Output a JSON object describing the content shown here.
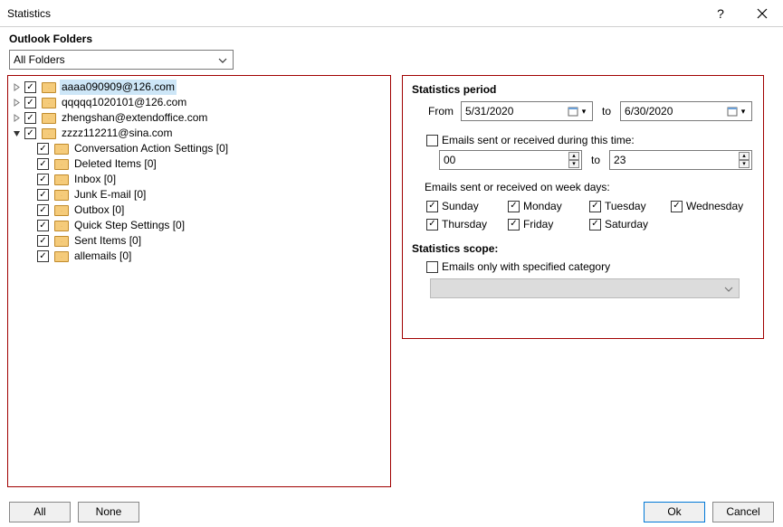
{
  "window": {
    "title": "Statistics",
    "help": "?",
    "close": "✕"
  },
  "outlook_folders": {
    "label": "Outlook Folders",
    "dropdown": "All Folders",
    "accounts": [
      {
        "name": "aaaa090909@126.com",
        "expanded": false,
        "checked": true,
        "selected": true
      },
      {
        "name": "qqqqq1020101@126.com",
        "expanded": false,
        "checked": true
      },
      {
        "name": "zhengshan@extendoffice.com",
        "expanded": false,
        "checked": true
      },
      {
        "name": "zzzz112211@sina.com",
        "expanded": true,
        "checked": true,
        "children": [
          {
            "name": "Conversation Action Settings [0]",
            "checked": true
          },
          {
            "name": "Deleted Items [0]",
            "checked": true
          },
          {
            "name": "Inbox [0]",
            "checked": true
          },
          {
            "name": "Junk E-mail [0]",
            "checked": true
          },
          {
            "name": "Outbox [0]",
            "checked": true
          },
          {
            "name": "Quick Step Settings [0]",
            "checked": true
          },
          {
            "name": "Sent Items [0]",
            "checked": true
          },
          {
            "name": "allemails [0]",
            "checked": true
          }
        ]
      }
    ]
  },
  "period": {
    "header": "Statistics period",
    "from_label": "From",
    "from_value": "5/31/2020",
    "to_label": "to",
    "to_value": "6/30/2020",
    "time_filter_label": "Emails sent or received during this time:",
    "time_filter_checked": false,
    "from_hour": "00",
    "to_hour": "23",
    "weekday_label": "Emails sent or received on week days:",
    "days": [
      {
        "label": "Sunday",
        "checked": true
      },
      {
        "label": "Monday",
        "checked": true
      },
      {
        "label": "Tuesday",
        "checked": true
      },
      {
        "label": "Wednesday",
        "checked": true
      },
      {
        "label": "Thursday",
        "checked": true
      },
      {
        "label": "Friday",
        "checked": true
      },
      {
        "label": "Saturday",
        "checked": true
      }
    ],
    "scope_header": "Statistics scope:",
    "scope_cat_label": "Emails only with specified category",
    "scope_cat_checked": false,
    "scope_cat_value": ""
  },
  "buttons": {
    "all": "All",
    "none": "None",
    "ok": "Ok",
    "cancel": "Cancel"
  }
}
